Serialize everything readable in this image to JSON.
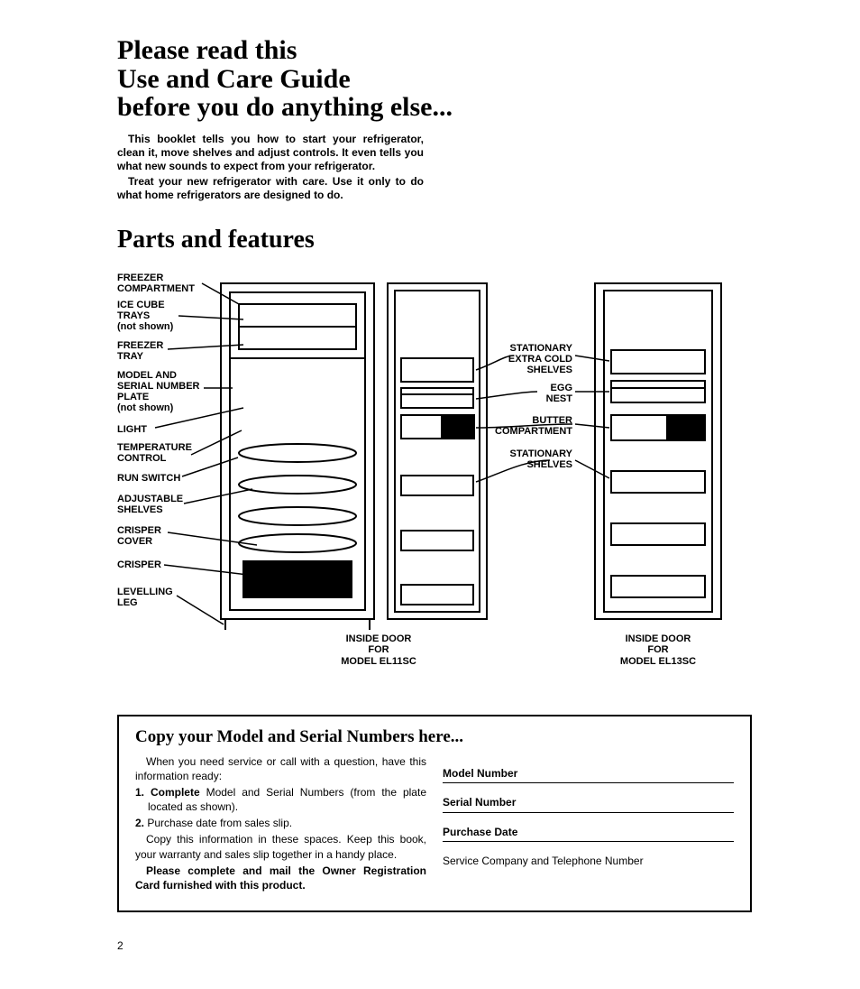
{
  "title_lines": [
    "Please read this",
    "Use and Care Guide",
    "before you do anything else..."
  ],
  "intro": {
    "p1": "This booklet tells you how to start your refrigerator, clean it, move shelves and adjust controls. It even tells you what new sounds to expect from your refrigerator.",
    "p2": "Treat your new refrigerator with care. Use it only to do what home refrigerators are designed to do."
  },
  "parts_heading": "Parts and features",
  "labels": {
    "freezer_comp": "FREEZER\nCOMPARTMENT",
    "ice_cube": "ICE CUBE\nTRAYS\n(not shown)",
    "freezer_tray": "FREEZER\nTRAY",
    "model_serial": "MODEL AND\nSERIAL NUMBER\nPLATE\n(not shown)",
    "light": "LIGHT",
    "temp": "TEMPERATURE\nCONTROL",
    "run": "RUN SWITCH",
    "adj": "ADJUSTABLE\nSHELVES",
    "crispercover": "CRISPER\nCOVER",
    "crisper": "CRISPER",
    "leg": "LEVELLING\nLEG",
    "extra_cold": "STATIONARY\nEXTRA COLD\nSHELVES",
    "egg": "EGG\nNEST",
    "butter": "BUTTER\nCOMPARTMENT",
    "stat_shelves": "STATIONARY\nSHELVES"
  },
  "caption1": "INSIDE DOOR\nFOR\nMODEL EL11SC",
  "caption2": "INSIDE DOOR\nFOR\nMODEL EL13SC",
  "infobox": {
    "heading": "Copy your Model and Serial Numbers here...",
    "left": {
      "l1": "When you need service or call with a question, have this information ready:",
      "l2a": "1. Complete",
      "l2b": " Model and Serial Numbers (from the plate located as shown).",
      "l3a": "2.",
      "l3b": " Purchase date from sales slip.",
      "l4": "Copy this information in these spaces. Keep this book, your warranty and sales slip together in a handy place.",
      "l5": "Please complete and mail the Owner Registration Card furnished with this product."
    },
    "fields": {
      "model": "Model Number",
      "serial": "Serial Number",
      "date": "Purchase Date",
      "svc": "Service Company and Telephone Number"
    }
  },
  "page_number": "2"
}
